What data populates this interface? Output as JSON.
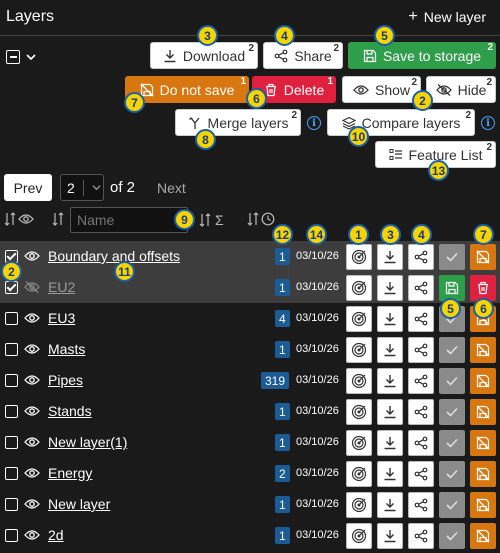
{
  "header": {
    "title": "Layers",
    "new_layer": "New layer"
  },
  "toolbar": {
    "download": {
      "label": "Download",
      "count": "2"
    },
    "share": {
      "label": "Share",
      "count": "2"
    },
    "save": {
      "label": "Save to storage",
      "count": "2"
    },
    "donotsave": {
      "label": "Do not save",
      "count": "1"
    },
    "delete": {
      "label": "Delete",
      "count": "1"
    },
    "show": {
      "label": "Show",
      "count": "2"
    },
    "hide": {
      "label": "Hide",
      "count": "2"
    },
    "merge": {
      "label": "Merge layers",
      "count": "2"
    },
    "compare": {
      "label": "Compare layers",
      "count": "2"
    },
    "featurelist": {
      "label": "Feature List",
      "count": "2"
    }
  },
  "pager": {
    "prev": "Prev",
    "page": "2",
    "of": "of 2",
    "next": "Next"
  },
  "filter": {
    "name_placeholder": "Name",
    "sigma": "Σ"
  },
  "badges": [
    "3",
    "4",
    "5",
    "7",
    "6",
    "2",
    "8",
    "10",
    "13",
    "9",
    "12",
    "14",
    "1",
    "3",
    "4",
    "7",
    "2",
    "11",
    "5",
    "6",
    "1"
  ],
  "colors": {
    "save": "#2e9e4a",
    "donotsave": "#d8760f",
    "delete": "#e0203f",
    "count_badge": "#1c5c96",
    "callout": "#f5d400"
  },
  "layers": [
    {
      "name": "Boundary and offsets",
      "count": "1",
      "date": "03/10/26",
      "checked": true,
      "visible": true
    },
    {
      "name": "EU2",
      "count": "1",
      "date": "03/10/26",
      "checked": true,
      "visible": false
    },
    {
      "name": "EU3",
      "count": "4",
      "date": "03/10/26",
      "checked": false,
      "visible": true
    },
    {
      "name": "Masts",
      "count": "1",
      "date": "03/10/26",
      "checked": false,
      "visible": true
    },
    {
      "name": "Pipes",
      "count": "319",
      "date": "03/10/26",
      "checked": false,
      "visible": true
    },
    {
      "name": "Stands",
      "count": "1",
      "date": "03/10/26",
      "checked": false,
      "visible": true
    },
    {
      "name": "New layer(1)",
      "count": "1",
      "date": "03/10/26",
      "checked": false,
      "visible": true
    },
    {
      "name": "Energy",
      "count": "2",
      "date": "03/10/26",
      "checked": false,
      "visible": true
    },
    {
      "name": "New layer",
      "count": "1",
      "date": "03/10/26",
      "checked": false,
      "visible": true
    },
    {
      "name": "2d",
      "count": "1",
      "date": "03/10/26",
      "checked": false,
      "visible": true
    }
  ]
}
